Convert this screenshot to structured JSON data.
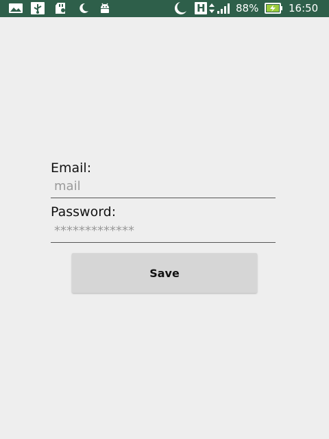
{
  "status_bar": {
    "background": "#2e5f4a",
    "left_icons": [
      "image-icon",
      "usb-icon",
      "sd-card-icon",
      "moon-icon",
      "android-icon"
    ],
    "right_icons": [
      "moon-icon",
      "network-h-icon",
      "data-arrows-icon",
      "signal-icon",
      "battery-charging-icon"
    ],
    "network_type": "H",
    "battery": "88%",
    "time": "16:50"
  },
  "form": {
    "email_label": "Email:",
    "email_placeholder": "mail",
    "email_value": "",
    "password_label": "Password:",
    "password_placeholder": "*************",
    "password_value": "",
    "save_label": "Save"
  }
}
